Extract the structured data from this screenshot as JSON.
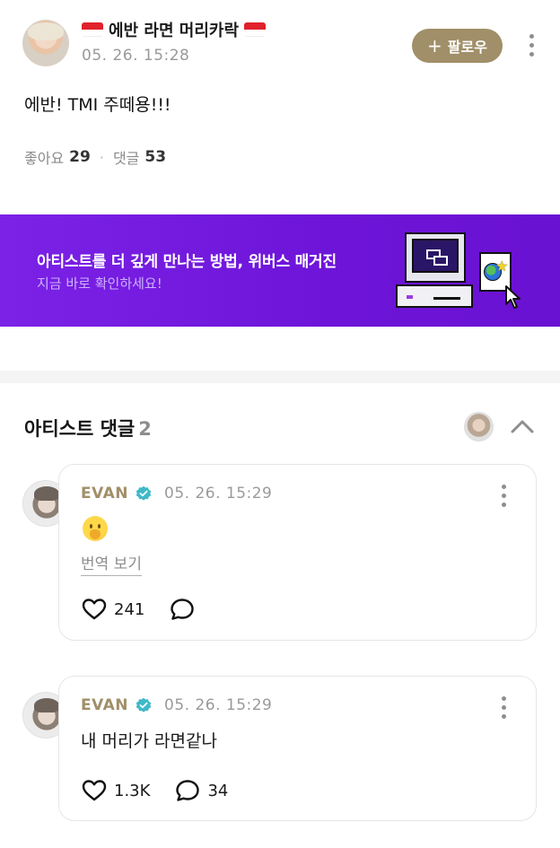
{
  "post": {
    "author_name": "에반 라면 머리카락",
    "time": "05. 26. 15:28",
    "follow_label": "팔로우",
    "follow_plus": "+",
    "text": "에반! TMI 주떼용!!!",
    "likes_label": "좋아요",
    "likes_count": "29",
    "comments_label": "댓글",
    "comments_count": "53"
  },
  "banner": {
    "title": "아티스트를 더 깊게 만나는 방법, 위버스 매거진",
    "subtitle": "지금 바로 확인하세요!",
    "bg_color": "#7020dd"
  },
  "artist_comments": {
    "title": "아티스트 댓글",
    "count": "2",
    "items": [
      {
        "author": "EVAN",
        "time": "05. 26. 15:29",
        "emoji": "shushing-face-emoji",
        "translate_label": "번역 보기",
        "likes": "241",
        "replies": ""
      },
      {
        "author": "EVAN",
        "time": "05. 26. 15:29",
        "text": "내 머리가 라면같나",
        "likes": "1.3K",
        "replies": "34"
      }
    ]
  },
  "colors": {
    "accent": "#a08f68",
    "verified": "#3fb9c8",
    "flag_red": "#e0212c"
  }
}
